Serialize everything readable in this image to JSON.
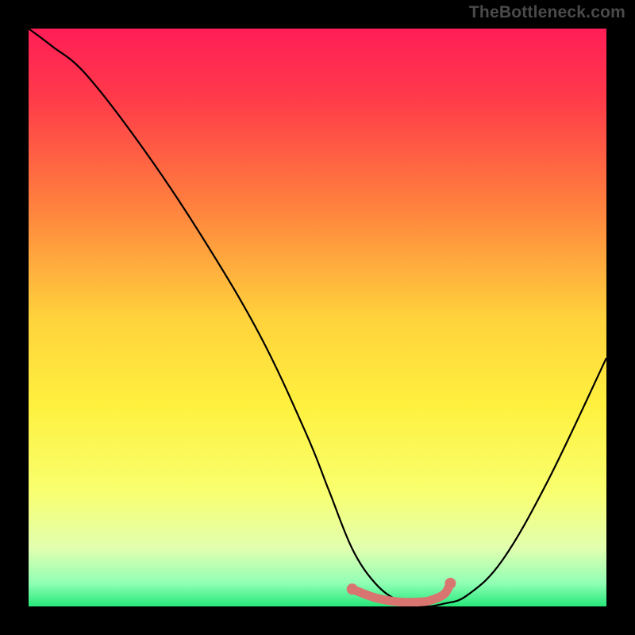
{
  "watermark": "TheBottleneck.com",
  "chart_data": {
    "type": "line",
    "title": "",
    "xlabel": "",
    "ylabel": "",
    "xlim": [
      0,
      100
    ],
    "ylim": [
      0,
      100
    ],
    "gradient_stops": [
      {
        "offset": 0,
        "color": "#ff1e56"
      },
      {
        "offset": 12,
        "color": "#ff3a4a"
      },
      {
        "offset": 30,
        "color": "#ff7e3e"
      },
      {
        "offset": 50,
        "color": "#ffd23c"
      },
      {
        "offset": 65,
        "color": "#fff03e"
      },
      {
        "offset": 80,
        "color": "#f9ff6e"
      },
      {
        "offset": 90,
        "color": "#e1ffb0"
      },
      {
        "offset": 96,
        "color": "#90ffb4"
      },
      {
        "offset": 100,
        "color": "#26e87a"
      }
    ],
    "series": [
      {
        "name": "bottleneck-curve",
        "color": "#000000",
        "x": [
          0,
          4,
          10,
          20,
          30,
          40,
          48,
          52,
          56,
          60,
          64,
          68,
          72,
          76,
          82,
          90,
          100
        ],
        "y": [
          100,
          97,
          92,
          79,
          64,
          47,
          30,
          20,
          10,
          4,
          1,
          0,
          0.5,
          2,
          8,
          22,
          43
        ]
      },
      {
        "name": "highlight-segment",
        "color": "#d97570",
        "x": [
          56,
          60,
          64,
          68,
          70,
          72,
          73
        ],
        "y": [
          3,
          1.5,
          0.8,
          0.8,
          1.2,
          2.2,
          4
        ]
      }
    ],
    "highlight_points": [
      {
        "x": 56,
        "y": 3
      },
      {
        "x": 73,
        "y": 4
      }
    ]
  }
}
